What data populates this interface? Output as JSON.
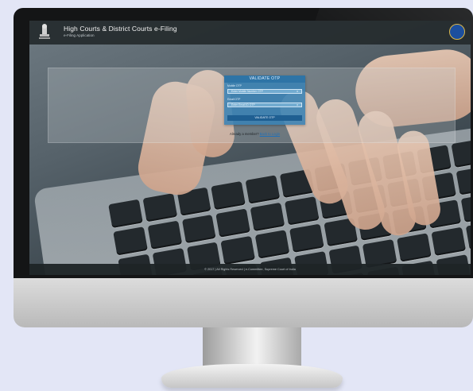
{
  "header": {
    "title": "High Courts & District Courts e-Filing",
    "subtitle": "e-Filing Application",
    "emblem_icon": "national-emblem-icon",
    "seal_icon": "supreme-court-seal-icon"
  },
  "login_card": {
    "heading": "VALIDATE OTP",
    "mobile_label": "Mobile OTP",
    "mobile_value": "Enter Mobile Number OTP",
    "email_label": "Email OTP",
    "email_value": "Enter Email ID OTP",
    "field_mark": "x",
    "validate_button": "VALIDATE OTP"
  },
  "already_row": {
    "prompt": "Already a member?",
    "link": "Back to Login"
  },
  "footer": {
    "text": "© 2017 | All Rights Reserved | e-Committee, Supreme Court of India"
  },
  "colors": {
    "page_background": "#e3e6f6",
    "card_blue": "#3a82b4",
    "button_blue": "#1f5f92"
  }
}
